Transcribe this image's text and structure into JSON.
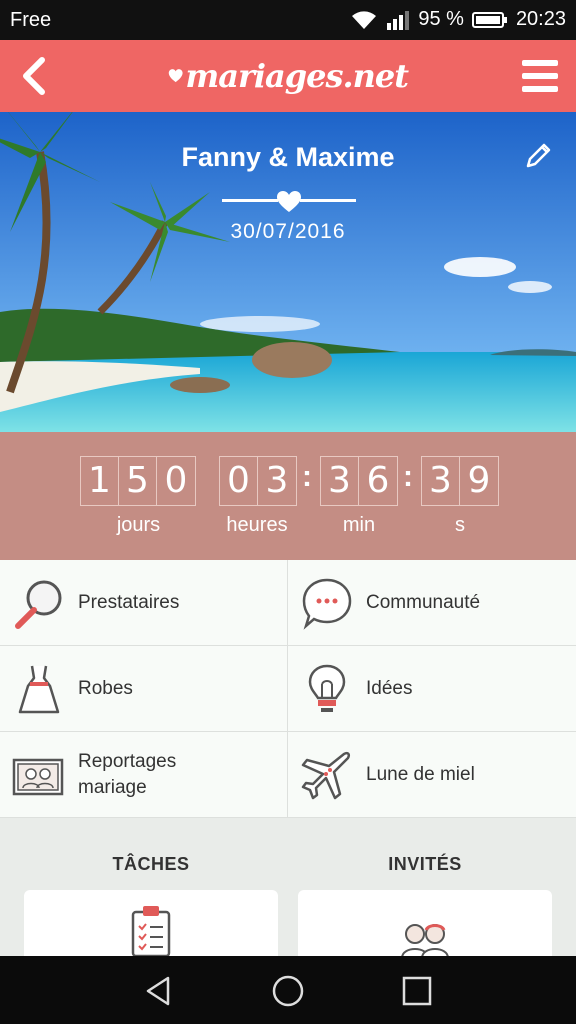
{
  "status_bar": {
    "carrier": "Free",
    "battery": "95 %",
    "time": "20:23"
  },
  "header": {
    "brand": "mariages.net"
  },
  "hero": {
    "couple": "Fanny & Maxime",
    "date": "30/07/2016"
  },
  "countdown": {
    "days": [
      "1",
      "5",
      "0"
    ],
    "hours": [
      "0",
      "3"
    ],
    "minutes": [
      "3",
      "6"
    ],
    "seconds": [
      "3",
      "9"
    ],
    "labels": {
      "days": "jours",
      "hours": "heures",
      "minutes": "min",
      "seconds": "s"
    }
  },
  "menu": {
    "prestataires": "Prestataires",
    "communaute": "Communauté",
    "robes": "Robes",
    "idees": "Idées",
    "reportages_1": "Reportages",
    "reportages_2": "mariage",
    "lune": "Lune de miel"
  },
  "sections": {
    "taches": "TÂCHES",
    "invites": "INVITÉS"
  },
  "colors": {
    "header": "#ef6664",
    "countdown": "#c48d84",
    "accent": "#e05a58"
  }
}
